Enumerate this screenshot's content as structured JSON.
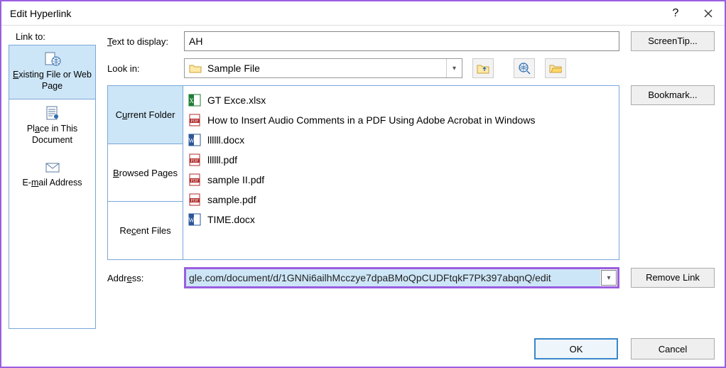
{
  "window": {
    "title": "Edit Hyperlink"
  },
  "linkto": {
    "label_pre": "L",
    "label_post": "ink to:",
    "items": [
      {
        "pre": "E",
        "post": "xisting File or Web Page",
        "text": "Existing File or Web Page",
        "icon": "page-web"
      },
      {
        "pre": "Pl",
        "u": "a",
        "post": "ce in This Document",
        "text": "Place in This Document",
        "icon": "doc-pin"
      },
      {
        "pre": "E-",
        "u": "m",
        "post": "ail Address",
        "text": "E-mail Address",
        "icon": "mail"
      }
    ]
  },
  "text_to_display": {
    "label_pre": "T",
    "label_post": "ext to display:",
    "value": "AH"
  },
  "screentip_label": "ScreenTip...",
  "lookin": {
    "label_pre": "L",
    "label_post": "ook in:",
    "value": "Sample File"
  },
  "subtabs": {
    "current": {
      "pre": "C",
      "u": "u",
      "post": "rrent Folder"
    },
    "browsed": {
      "pre": "",
      "u": "B",
      "post": "rowsed Pages"
    },
    "recent": {
      "pre": "Re",
      "u": "c",
      "post": "ent Files"
    }
  },
  "files": [
    {
      "icon": "xlsx",
      "name": "GT Exce.xlsx"
    },
    {
      "icon": "pdf",
      "name": "How to Insert Audio Comments in a PDF Using Adobe Acrobat in Windows"
    },
    {
      "icon": "docx",
      "name": "llllll.docx"
    },
    {
      "icon": "pdf",
      "name": "llllll.pdf"
    },
    {
      "icon": "pdf",
      "name": "sample II.pdf"
    },
    {
      "icon": "pdf",
      "name": "sample.pdf"
    },
    {
      "icon": "docx",
      "name": "TIME.docx"
    }
  ],
  "bookmark_label": "Bookmark...",
  "address": {
    "label_pre": "Addr",
    "label_u": "e",
    "label_post": "ss:",
    "value": "gle.com/document/d/1GNNi6ailhMcczye7dpaBMoQpCUDFtqkF7Pk397abqnQ/edit"
  },
  "remove_link_label": "Remove Link",
  "ok_label": "OK",
  "cancel_label": "Cancel"
}
